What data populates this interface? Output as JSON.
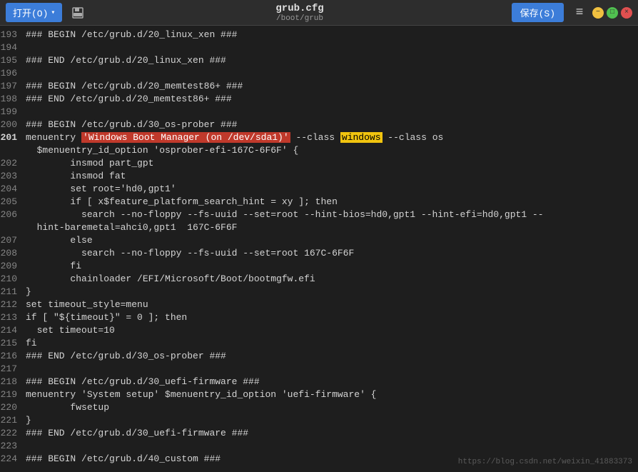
{
  "titlebar": {
    "open_label": "打开(O)",
    "save_label": "保存(S)",
    "filename": "grub.cfg",
    "path": "/boot/grub"
  },
  "lines": [
    {
      "num": "193",
      "content": "### BEGIN /etc/grub.d/20_linux_xen ###",
      "type": "normal"
    },
    {
      "num": "194",
      "content": "",
      "type": "normal"
    },
    {
      "num": "195",
      "content": "### END /etc/grub.d/20_linux_xen ###",
      "type": "normal"
    },
    {
      "num": "196",
      "content": "",
      "type": "normal"
    },
    {
      "num": "197",
      "content": "### BEGIN /etc/grub.d/20_memtest86+ ###",
      "type": "normal"
    },
    {
      "num": "198",
      "content": "### END /etc/grub.d/20_memtest86+ ###",
      "type": "normal"
    },
    {
      "num": "199",
      "content": "",
      "type": "normal"
    },
    {
      "num": "200",
      "content": "### BEGIN /etc/grub.d/30_os-prober ###",
      "type": "normal"
    },
    {
      "num": "201",
      "content_parts": [
        {
          "text": "menuentry ",
          "style": "normal"
        },
        {
          "text": "'Windows Boot Manager (on /dev/sda1)'",
          "style": "hl-string-orange"
        },
        {
          "text": " --class ",
          "style": "normal"
        },
        {
          "text": "windows",
          "style": "hl-word-yellow"
        },
        {
          "text": " --class os",
          "style": "normal"
        }
      ],
      "type": "special",
      "current": true
    },
    {
      "num": "",
      "content": "  $menuentry_id_option 'osprober-efi-167C-6F6F' {",
      "type": "normal"
    },
    {
      "num": "202",
      "content": "        insmod part_gpt",
      "type": "normal"
    },
    {
      "num": "203",
      "content": "        insmod fat",
      "type": "normal"
    },
    {
      "num": "204",
      "content": "        set root='hd0,gpt1'",
      "type": "normal"
    },
    {
      "num": "205",
      "content": "        if [ x$feature_platform_search_hint = xy ]; then",
      "type": "normal"
    },
    {
      "num": "206",
      "content": "          search --no-floppy --fs-uuid --set=root --hint-bios=hd0,gpt1 --hint-efi=hd0,gpt1 --",
      "type": "normal"
    },
    {
      "num": "",
      "content": "  hint-baremetal=ahci0,gpt1  167C-6F6F",
      "type": "normal"
    },
    {
      "num": "207",
      "content": "        else",
      "type": "normal"
    },
    {
      "num": "208",
      "content": "          search --no-floppy --fs-uuid --set=root 167C-6F6F",
      "type": "normal"
    },
    {
      "num": "209",
      "content": "        fi",
      "type": "normal"
    },
    {
      "num": "210",
      "content": "        chainloader /EFI/Microsoft/Boot/bootmgfw.efi",
      "type": "normal"
    },
    {
      "num": "211",
      "content": "}",
      "type": "normal"
    },
    {
      "num": "212",
      "content": "set timeout_style=menu",
      "type": "normal"
    },
    {
      "num": "213",
      "content": "if [ \"${timeout}\" = 0 ]; then",
      "type": "normal"
    },
    {
      "num": "214",
      "content": "  set timeout=10",
      "type": "normal"
    },
    {
      "num": "215",
      "content": "fi",
      "type": "normal"
    },
    {
      "num": "216",
      "content": "### END /etc/grub.d/30_os-prober ###",
      "type": "normal"
    },
    {
      "num": "217",
      "content": "",
      "type": "normal"
    },
    {
      "num": "218",
      "content": "### BEGIN /etc/grub.d/30_uefi-firmware ###",
      "type": "normal"
    },
    {
      "num": "219",
      "content": "menuentry 'System setup' $menuentry_id_option 'uefi-firmware' {",
      "type": "normal"
    },
    {
      "num": "220",
      "content": "        fwsetup",
      "type": "normal"
    },
    {
      "num": "221",
      "content": "}",
      "type": "normal"
    },
    {
      "num": "222",
      "content": "### END /etc/grub.d/30_uefi-firmware ###",
      "type": "normal"
    },
    {
      "num": "223",
      "content": "",
      "type": "normal"
    },
    {
      "num": "224",
      "content": "### BEGIN /etc/grub.d/40_custom ###",
      "type": "normal"
    }
  ],
  "watermark": "https://blog.csdn.net/weixin_41883373"
}
